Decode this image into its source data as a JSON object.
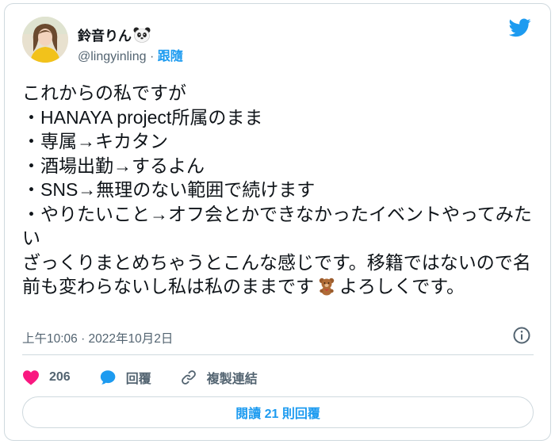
{
  "author": {
    "display_name": "鈴音りん",
    "handle": "@lingyinling",
    "separator": " · ",
    "follow_label": "跟隨"
  },
  "tweet": {
    "lines": [
      "これからの私ですが",
      "・HANAYA project所属のまま",
      "・専属→キカタン",
      "・酒場出勤→するよん",
      "・SNS→無理のない範囲で続けます",
      "・やりたいこと→オフ会とかできなかったイベントやってみたい"
    ],
    "closing_before_emoji": "ざっくりまとめちゃうとこんな感じです。移籍ではないので名前も変わらないし私は私のままです",
    "closing_after_emoji": "よろしくです。"
  },
  "timestamp": "上午10:06 · 2022年10月2日",
  "actions": {
    "likes_count": "206",
    "reply_label": "回覆",
    "copy_link_label": "複製連結"
  },
  "read_replies_label": "閱讀 21 則回覆",
  "colors": {
    "twitter_blue": "#1d9bf0",
    "like_pink": "#f91880",
    "text_primary": "#0f1419",
    "text_secondary": "#536471",
    "border": "#cfd9de"
  },
  "icons": [
    "twitter-bird-icon",
    "panda-emoji-icon",
    "teddy-bear-emoji-icon",
    "info-icon",
    "heart-icon",
    "reply-bubble-icon",
    "link-icon"
  ]
}
